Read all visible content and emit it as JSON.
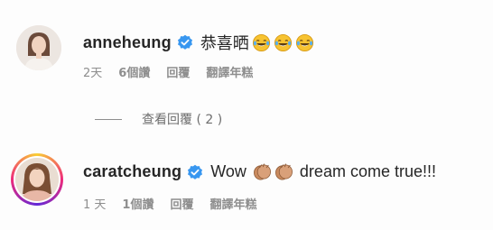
{
  "comments": [
    {
      "username": "anneheung",
      "verified": true,
      "text": "恭喜晒",
      "emojis": [
        "laughing-tears-emoji",
        "laughing-tears-emoji",
        "laughing-tears-emoji"
      ],
      "time": "2天",
      "likes": "6個讚",
      "reply_label": "回覆",
      "translate_label": "翻譯年糕",
      "view_replies": "查看回覆 ( 2 )"
    },
    {
      "username": "caratcheung",
      "verified": true,
      "text_before": "Wow",
      "emojis": [
        "clapping-hands-emoji",
        "clapping-hands-emoji"
      ],
      "text_after": "dream come true!!!",
      "time": "1 天",
      "likes": "1個讚",
      "reply_label": "回覆",
      "translate_label": "翻譯年糕",
      "has_story_ring": true
    }
  ],
  "colors": {
    "verified": "#3897f0",
    "meta": "#8e8e8e",
    "text": "#262626"
  }
}
